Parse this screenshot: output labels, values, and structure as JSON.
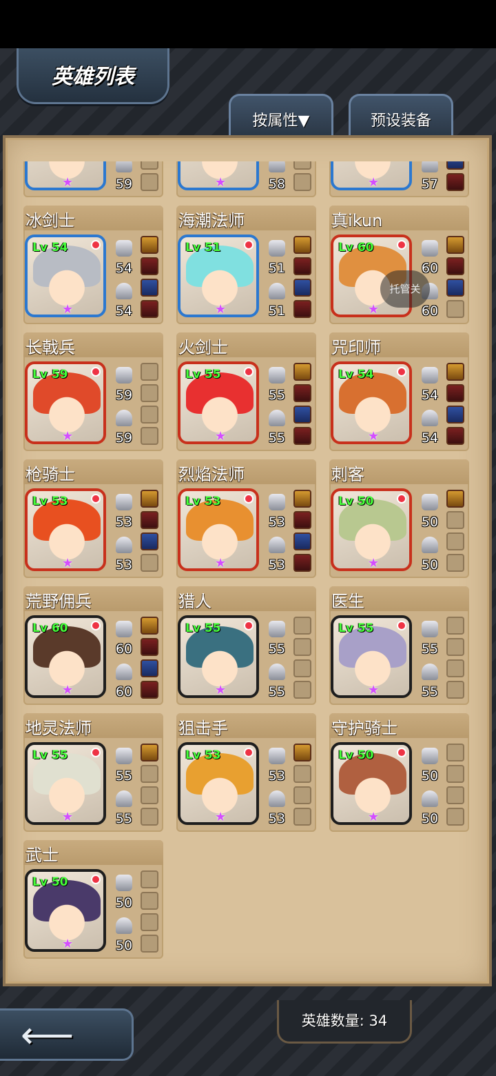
{
  "header": {
    "title": "英雄列表"
  },
  "tabs": [
    {
      "label": "按属性▼"
    },
    {
      "label": "预设装备"
    }
  ],
  "auto_badge": "托管关",
  "footer": {
    "hero_count_label": "英雄数量: 34"
  },
  "colors": {
    "panel": "#d9c19b",
    "level_text": "#46ff3a",
    "star": "#d44dff"
  },
  "heroes": [
    {
      "name": "",
      "level": "",
      "atk": "",
      "def": "59",
      "frame": "blue",
      "hair": "#d8b88a",
      "slots": [
        0,
        0,
        0,
        0
      ]
    },
    {
      "name": "",
      "level": "",
      "atk": "",
      "def": "58",
      "frame": "blue",
      "hair": "#8a4a2a",
      "slots": [
        1,
        0,
        0,
        0
      ]
    },
    {
      "name": "",
      "level": "",
      "atk": "",
      "def": "57",
      "frame": "blue",
      "hair": "#f0d040",
      "slots": [
        1,
        1,
        1,
        1
      ]
    },
    {
      "name": "冰剑士",
      "level": "Lv 54",
      "atk": "54",
      "def": "54",
      "frame": "blue",
      "hair": "#b8bcc4",
      "slots": [
        1,
        1,
        1,
        1
      ]
    },
    {
      "name": "海潮法师",
      "level": "Lv 51",
      "atk": "51",
      "def": "51",
      "frame": "blue",
      "hair": "#80e0e0",
      "slots": [
        1,
        1,
        1,
        1
      ]
    },
    {
      "name": "真ikun",
      "level": "Lv 60",
      "atk": "60",
      "def": "60",
      "frame": "red",
      "hair": "#e09040",
      "slots": [
        1,
        1,
        1,
        0
      ]
    },
    {
      "name": "长戟兵",
      "level": "Lv 59",
      "atk": "59",
      "def": "59",
      "frame": "red",
      "hair": "#e04a2a",
      "slots": [
        0,
        0,
        0,
        0
      ]
    },
    {
      "name": "火剑士",
      "level": "Lv 55",
      "atk": "55",
      "def": "55",
      "frame": "red",
      "hair": "#e83030",
      "slots": [
        1,
        1,
        1,
        1
      ]
    },
    {
      "name": "咒印师",
      "level": "Lv 54",
      "atk": "54",
      "def": "54",
      "frame": "red",
      "hair": "#d87030",
      "slots": [
        1,
        1,
        1,
        1
      ]
    },
    {
      "name": "枪骑士",
      "level": "Lv 53",
      "atk": "53",
      "def": "53",
      "frame": "red",
      "hair": "#e85020",
      "slots": [
        1,
        1,
        1,
        0
      ]
    },
    {
      "name": "烈焰法师",
      "level": "Lv 53",
      "atk": "53",
      "def": "53",
      "frame": "red",
      "hair": "#e89030",
      "slots": [
        1,
        1,
        1,
        1
      ]
    },
    {
      "name": "刺客",
      "level": "Lv 50",
      "atk": "50",
      "def": "50",
      "frame": "red",
      "hair": "#b8c890",
      "slots": [
        1,
        0,
        0,
        0
      ]
    },
    {
      "name": "荒野佣兵",
      "level": "Lv 60",
      "atk": "60",
      "def": "60",
      "frame": "dark",
      "hair": "#5a3a2a",
      "slots": [
        1,
        1,
        1,
        1
      ]
    },
    {
      "name": "猎人",
      "level": "Lv 55",
      "atk": "55",
      "def": "55",
      "frame": "dark",
      "hair": "#3a7080",
      "slots": [
        0,
        0,
        0,
        0
      ]
    },
    {
      "name": "医生",
      "level": "Lv 55",
      "atk": "55",
      "def": "55",
      "frame": "dark",
      "hair": "#a8a0c8",
      "slots": [
        0,
        0,
        0,
        0
      ]
    },
    {
      "name": "地灵法师",
      "level": "Lv 55",
      "atk": "55",
      "def": "55",
      "frame": "dark",
      "hair": "#e0e0d0",
      "slots": [
        1,
        0,
        0,
        0
      ]
    },
    {
      "name": "狙击手",
      "level": "Lv 53",
      "atk": "53",
      "def": "53",
      "frame": "dark",
      "hair": "#e8a030",
      "slots": [
        1,
        0,
        0,
        0
      ]
    },
    {
      "name": "守护骑士",
      "level": "Lv 50",
      "atk": "50",
      "def": "50",
      "frame": "dark",
      "hair": "#b06040",
      "slots": [
        0,
        0,
        0,
        0
      ]
    },
    {
      "name": "武士",
      "level": "Lv 50",
      "atk": "50",
      "def": "50",
      "frame": "dark",
      "hair": "#4a3a6a",
      "slots": [
        0,
        0,
        0,
        0
      ]
    }
  ]
}
